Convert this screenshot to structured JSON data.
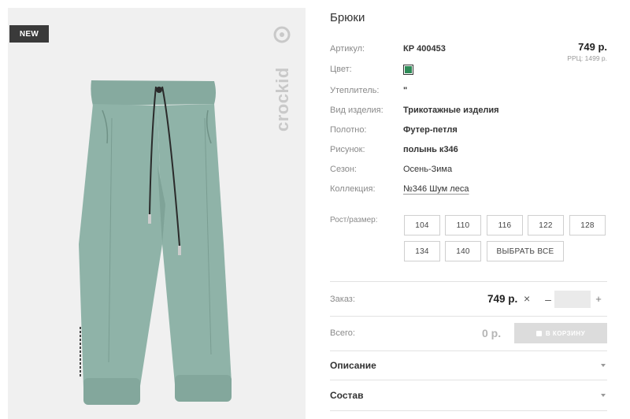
{
  "badge": "NEW",
  "brand": {
    "name": "crockid",
    "color": "#c9c9c9"
  },
  "product": {
    "title": "Брюки",
    "specs": [
      {
        "label": "Артикул:",
        "value": "КР 400453"
      },
      {
        "label": "Цвет:",
        "swatch_color": "#2e8b57"
      },
      {
        "label": "Утеплитель:",
        "value": "\""
      },
      {
        "label": "Вид изделия:",
        "value": "Трикотажные изделия"
      },
      {
        "label": "Полотно:",
        "value": "Футер-петля"
      },
      {
        "label": "Рисунок:",
        "value": "полынь к346"
      },
      {
        "label": "Сезон:",
        "value": "Осень-Зима"
      },
      {
        "label": "Коллекция:",
        "value": "№346 Шум леса"
      }
    ],
    "price": "749 р.",
    "rrp": "РРЦ: 1499 р.",
    "pants_color": "#8fb3a8"
  },
  "sizes": {
    "label": "Рост/размер:",
    "options": [
      "104",
      "110",
      "116",
      "122",
      "128",
      "134",
      "140"
    ],
    "select_all": "ВЫБРАТЬ ВСЕ"
  },
  "order": {
    "label": "Заказ:",
    "price": "749 р.",
    "times": "×",
    "minus": "–",
    "plus": "+",
    "quantity": ""
  },
  "total": {
    "label": "Всего:",
    "value": "0 р.",
    "cart_button": "В КОРЗИНУ"
  },
  "accordion": [
    {
      "title": "Описание"
    },
    {
      "title": "Состав"
    }
  ]
}
